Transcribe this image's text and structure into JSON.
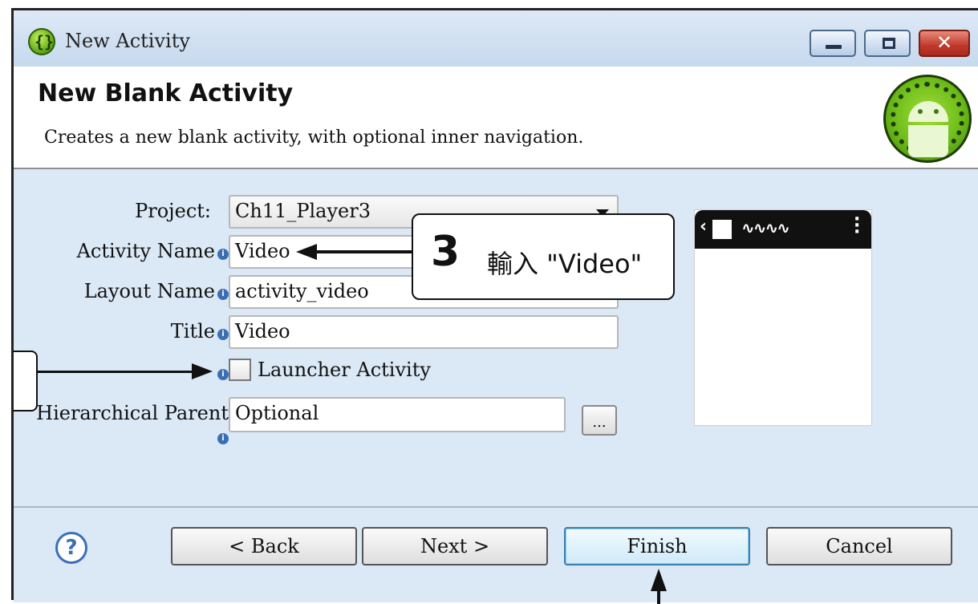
{
  "window": {
    "title": "New Activity"
  },
  "header": {
    "title": "New Blank Activity",
    "description": "Creates a new blank activity, with optional inner navigation."
  },
  "form": {
    "project": {
      "label": "Project:",
      "value": "Ch11_Player3"
    },
    "activity_name": {
      "label": "Activity Name",
      "value": "Video"
    },
    "layout_name": {
      "label": "Layout Name",
      "value": "activity_video"
    },
    "title": {
      "label": "Title",
      "value": "Video"
    },
    "launcher_activity": {
      "label": "Launcher Activity",
      "checked": false
    },
    "hierarchical_parent": {
      "label": "Hierarchical Parent",
      "value": "Optional"
    },
    "browse_label": "..."
  },
  "callout": {
    "number": "3",
    "text": "輸入 \"Video\""
  },
  "footer": {
    "back": "< Back",
    "next": "Next >",
    "finish": "Finish",
    "cancel": "Cancel"
  },
  "icons": {
    "info": "i",
    "help": "?"
  },
  "colors": {
    "accent": "#3c7fb1",
    "close_button": "#c0392b",
    "content_bg": "#dbe8f5"
  }
}
